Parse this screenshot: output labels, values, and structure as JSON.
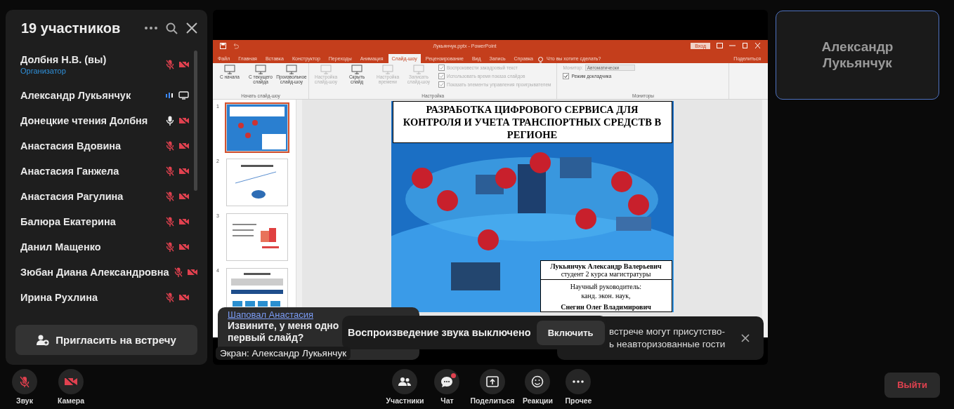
{
  "panel": {
    "title": "19 участников",
    "participants": [
      {
        "name": "Долбня Н.В. (вы)",
        "role": "Организатор",
        "muted": true,
        "sharing": false
      },
      {
        "name": "Александр Лукьянчук",
        "muted": false,
        "speaking": true,
        "sharing": true
      },
      {
        "name": "Донецкие чтения Долбня",
        "muted": false,
        "speaking": false,
        "sharing": false
      },
      {
        "name": "Анастасия Вдовина",
        "muted": true,
        "sharing": false
      },
      {
        "name": "Анастасия Ганжела",
        "muted": true,
        "sharing": false
      },
      {
        "name": "Анастасия Рагулина",
        "muted": true,
        "sharing": false
      },
      {
        "name": "Балюра Екатерина",
        "muted": true,
        "sharing": false
      },
      {
        "name": "Данил Мащенко",
        "muted": true,
        "sharing": false
      },
      {
        "name": "Зюбан Диана Александровна",
        "muted": true,
        "sharing": false
      },
      {
        "name": "Ирина Рухлина",
        "muted": true,
        "sharing": false
      }
    ],
    "invite_button": "Пригласить на встречу"
  },
  "share": {
    "app": {
      "title": "Лукьянчук.pptx - PowerPoint",
      "sign_in": "Вход",
      "share": "Поделиться",
      "tabs": [
        {
          "label": "Файл",
          "selected": false
        },
        {
          "label": "Главная",
          "selected": false
        },
        {
          "label": "Вставка",
          "selected": false
        },
        {
          "label": "Конструктор",
          "selected": false
        },
        {
          "label": "Переходы",
          "selected": false
        },
        {
          "label": "Анимация",
          "selected": false
        },
        {
          "label": "Слайд-шоу",
          "selected": true
        },
        {
          "label": "Рецензирование",
          "selected": false
        },
        {
          "label": "Вид",
          "selected": false
        },
        {
          "label": "Запись",
          "selected": false
        },
        {
          "label": "Справка",
          "selected": false
        }
      ],
      "search": "Что вы хотите сделать?",
      "groups": [
        {
          "label": "Начать слайд-шоу",
          "commands": [
            {
              "label": "С начала",
              "disabled": false
            },
            {
              "label": "С текущего слайда",
              "disabled": false
            },
            {
              "label": "Произвольное слайд-шоу",
              "disabled": false
            }
          ]
        },
        {
          "label": "Настройка",
          "commands": [
            {
              "label": "Настройка слайд-шоу",
              "disabled": true
            },
            {
              "label": "Скрыть слайд",
              "disabled": false
            },
            {
              "label": "Настройка времени",
              "disabled": true
            },
            {
              "label": "Записать слайд-шоу",
              "disabled": true
            }
          ],
          "checks": [
            {
              "label": "Воспроизвести закадровый текст",
              "checked": true,
              "disabled": true
            },
            {
              "label": "Использовать время показа слайдов",
              "checked": true,
              "disabled": true
            },
            {
              "label": "Показать элементы управления проигрывателем",
              "checked": true,
              "disabled": true
            }
          ]
        },
        {
          "label": "Мониторы",
          "monitor_label": "Монитор:",
          "monitor_value": "Автоматически",
          "checks": [
            {
              "label": "Режим докладчика",
              "checked": true,
              "disabled": false
            }
          ]
        }
      ]
    },
    "slides": [
      {
        "number": "1",
        "selected": true
      },
      {
        "number": "2",
        "selected": false
      },
      {
        "number": "3",
        "selected": false
      },
      {
        "number": "4",
        "selected": false
      }
    ],
    "slide": {
      "title": "РАЗРАБОТКА ЦИФРОВОГО СЕРВИСА ДЛЯ КОНТРОЛЯ И УЧЕТА ТРАНСПОРТНЫХ СРЕДСТВ В РЕГИОНЕ",
      "author": "Лукьянчук Александр Валерьевич",
      "author_note": "студент 2 курса магистратуры",
      "supervisor_lines": [
        "Научный руководитель:",
        "канд. экон. наук,"
      ],
      "supervisor": "Снегин Олег Владимирович"
    },
    "screen_label": "Экран: Александр Лукьянчук"
  },
  "chat_toast": {
    "author": "Шаповал Анастасия",
    "lines": [
      "Извините, у меня одно",
      "первый слайд?"
    ]
  },
  "sound_toast": {
    "message": "Воспроизведение звука выключено",
    "button": "Включить"
  },
  "guest_toast": {
    "lines": [
      "встрече могут присутство-",
      "ь неавторизованные гости"
    ]
  },
  "speaker_tile": {
    "name": "Александр Лукьянчук"
  },
  "toolbar": {
    "left": [
      {
        "label": "Звук",
        "kind": "mic",
        "on": false
      },
      {
        "label": "Камера",
        "kind": "camera",
        "on": false
      }
    ],
    "center": [
      {
        "label": "Участники",
        "kind": "people"
      },
      {
        "label": "Чат",
        "kind": "chat",
        "unread": true
      },
      {
        "label": "Поделиться",
        "kind": "share"
      },
      {
        "label": "Реакции",
        "kind": "reactions"
      },
      {
        "label": "Прочее",
        "kind": "more"
      }
    ],
    "leave": "Выйти"
  }
}
